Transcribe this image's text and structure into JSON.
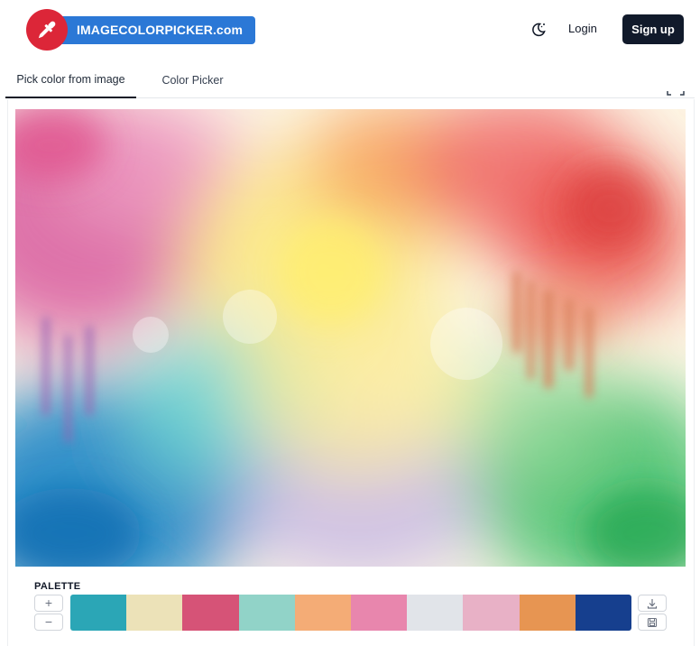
{
  "header": {
    "logo_text": "IMAGECOLORPICKER.com",
    "login_label": "Login",
    "signup_label": "Sign up",
    "theme_icon": "moon-sun-icon"
  },
  "tabs": [
    {
      "label": "Pick color from image",
      "active": true
    },
    {
      "label": "Color Picker",
      "active": false
    }
  ],
  "image": {
    "description_icon": "watercolor-image"
  },
  "palette": {
    "label": "PALETTE",
    "plus_label": "+",
    "minus_label": "−",
    "swatches": [
      {
        "color": "#2ba6b6"
      },
      {
        "color": "#ece2b8"
      },
      {
        "color": "#d65377"
      },
      {
        "color": "#91d3c8"
      },
      {
        "color": "#f4ac76"
      },
      {
        "color": "#e886ad"
      },
      {
        "color": "#e1e4e9"
      },
      {
        "color": "#e8b1c6"
      },
      {
        "color": "#e79552"
      },
      {
        "color": "#163f8e"
      }
    ]
  },
  "colors": {
    "brand_red": "#dc2638",
    "brand_blue": "#2b78d6",
    "signup_bg": "#111a2b"
  }
}
